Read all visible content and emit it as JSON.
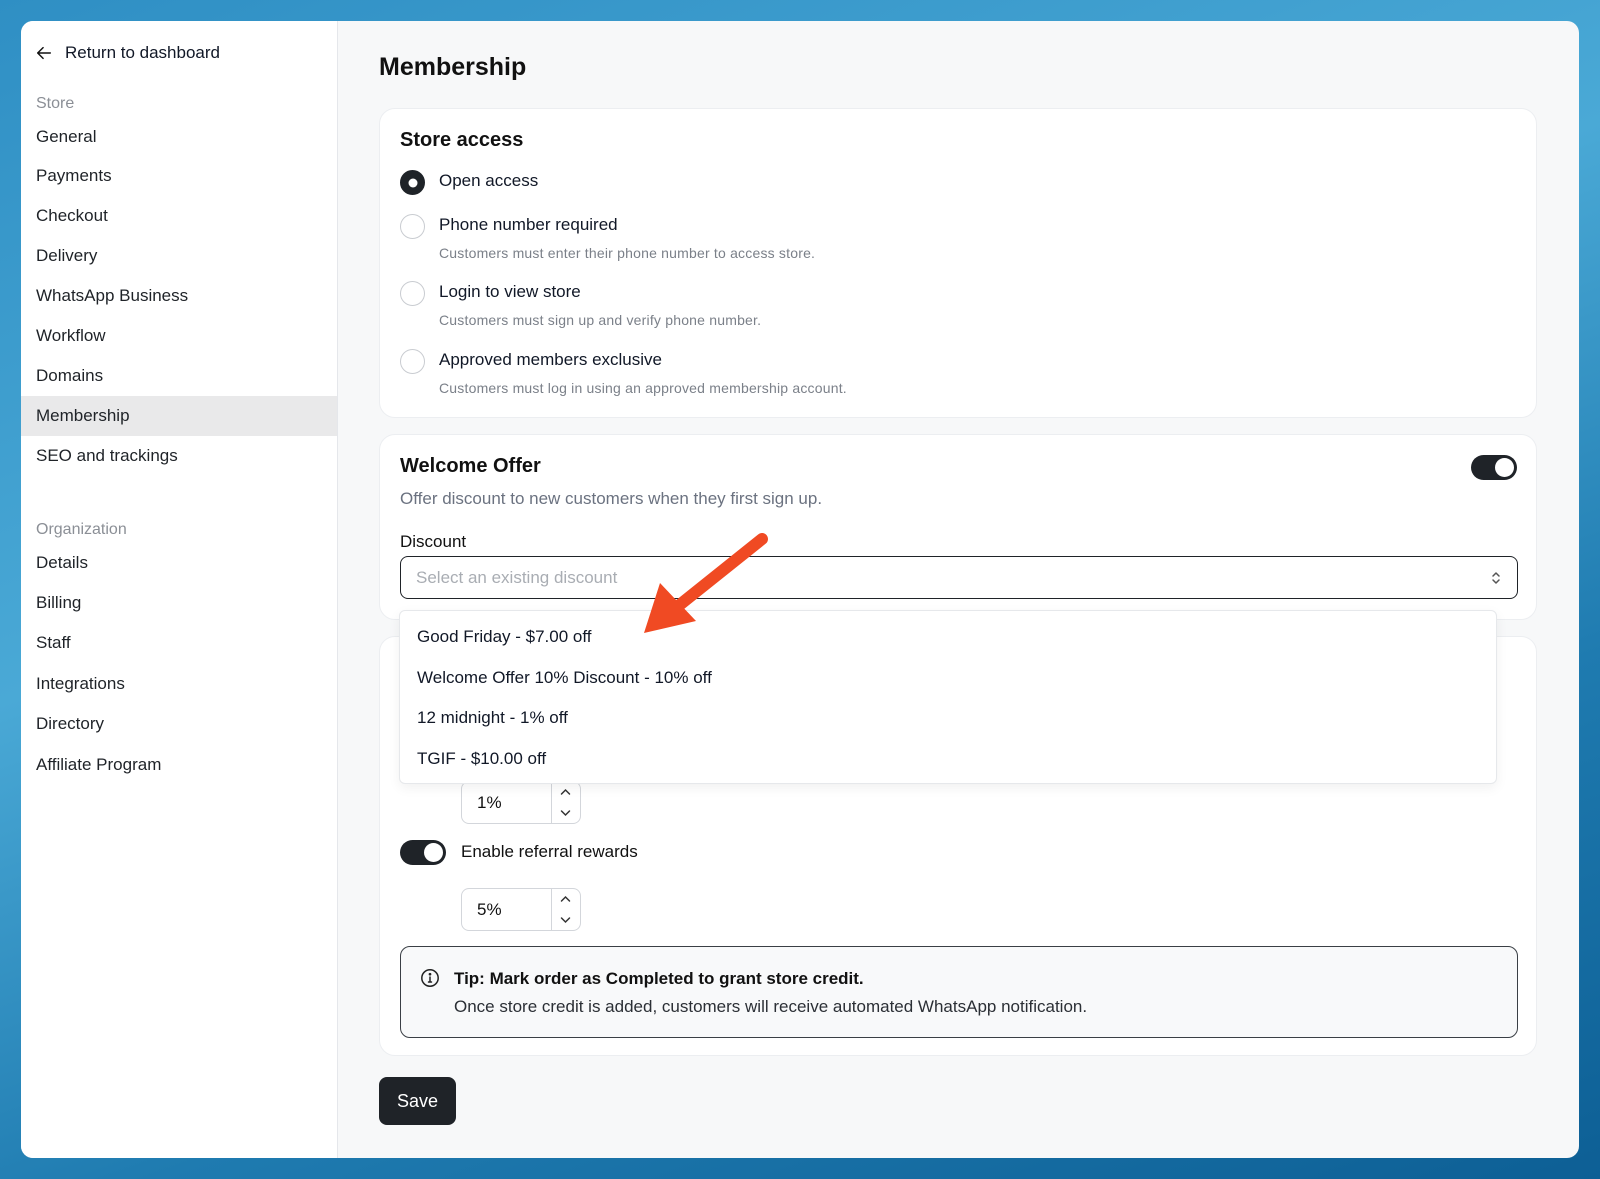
{
  "sidebar": {
    "back_label": "Return to dashboard",
    "store_section": "Store",
    "store_items": [
      "General",
      "Payments",
      "Checkout",
      "Delivery",
      "WhatsApp Business",
      "Workflow",
      "Domains",
      "Membership",
      "SEO and trackings"
    ],
    "active_item": "Membership",
    "org_section": "Organization",
    "org_items": [
      "Details",
      "Billing",
      "Staff",
      "Integrations",
      "Directory",
      "Affiliate Program"
    ]
  },
  "page": {
    "title": "Membership"
  },
  "store_access": {
    "title": "Store access",
    "options": [
      {
        "label": "Open access",
        "desc": "",
        "checked": true
      },
      {
        "label": "Phone number required",
        "desc": "Customers must enter their phone number to access store.",
        "checked": false
      },
      {
        "label": "Login to view store",
        "desc": "Customers must sign up and verify phone number.",
        "checked": false
      },
      {
        "label": "Approved members exclusive",
        "desc": "Customers must log in using an approved membership account.",
        "checked": false
      }
    ]
  },
  "welcome_offer": {
    "title": "Welcome Offer",
    "subtitle": "Offer discount to new customers when they first sign up.",
    "enabled": true,
    "discount_label": "Discount",
    "discount_placeholder": "Select an existing discount",
    "dropdown_options": [
      "Good Friday - $7.00 off",
      "Welcome Offer 10% Discount - 10% off",
      "12 midnight - 1% off",
      "TGIF - $10.00 off"
    ]
  },
  "rewards": {
    "store_credit_value": "1%",
    "referral_label": "Enable referral rewards",
    "referral_enabled": true,
    "referral_value": "5%"
  },
  "tip": {
    "title": "Tip: Mark order as Completed to grant store credit.",
    "body": "Once store credit is added, customers will receive automated WhatsApp notification."
  },
  "actions": {
    "save_label": "Save"
  },
  "colors": {
    "accent_dark": "#1f2328",
    "annotation_arrow": "#f04a23"
  }
}
